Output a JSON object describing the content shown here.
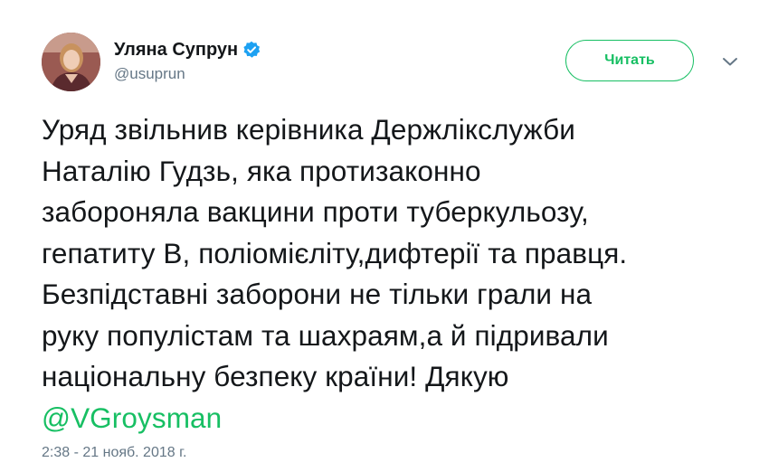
{
  "tweet": {
    "author": {
      "display_name": "Уляна Супрун",
      "handle": "@usuprun",
      "verified": true
    },
    "follow_button_label": "Читать",
    "menu_icon": "chevron-down-icon",
    "text_lines": [
      "Уряд звільнив керівника Держлікслужби",
      "Наталію Гудзь, яка протизаконно",
      "забороняла вакцини проти туберкульозу,",
      "гепатиту В, поліомієліту,дифтерії та правця.",
      "Безпідставні заборони не тільки грали на",
      "руку популістам та шахраям,а й підривали",
      "національну безпеку країни! Дякую"
    ],
    "mention": "@VGroysman",
    "timestamp": "2:38 - 21 нояб. 2018 г."
  },
  "colors": {
    "accent": "#17bf63",
    "verified_badge": "#1da1f2",
    "text": "#14171a",
    "secondary_text": "#657786"
  }
}
